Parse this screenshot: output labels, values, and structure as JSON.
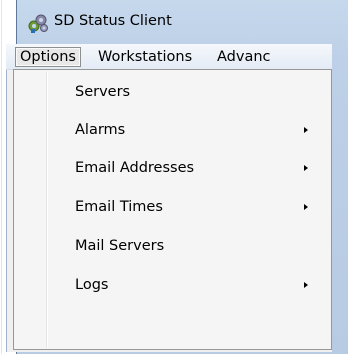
{
  "window": {
    "title": "SD Status Client",
    "icon": "gear-cluster-icon"
  },
  "menubar": {
    "items": [
      {
        "label": "Options",
        "active": true
      },
      {
        "label": "Workstations"
      },
      {
        "label": "Advanc"
      }
    ]
  },
  "dropdown": {
    "items": [
      {
        "label": "Servers",
        "submenu": false
      },
      {
        "label": "Alarms",
        "submenu": true
      },
      {
        "label": "Email Addresses",
        "submenu": true
      },
      {
        "label": "Email Times",
        "submenu": true
      },
      {
        "label": "Mail Servers",
        "submenu": false
      },
      {
        "label": "Logs",
        "submenu": true
      }
    ]
  },
  "colors": {
    "title_bar": "#c0d3ea",
    "menu_bg": "#f5f5f5",
    "menu_border": "#979797"
  }
}
